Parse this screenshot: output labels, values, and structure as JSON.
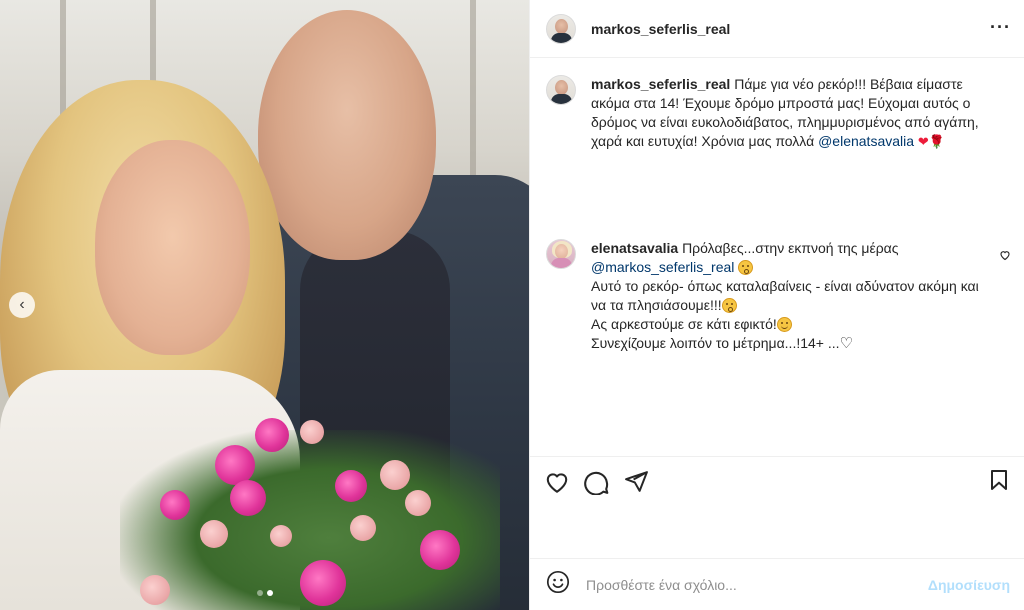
{
  "post": {
    "author": "markos_seferlis_real",
    "caption": {
      "username": "markos_seferlis_real",
      "text": "Πάμε για νέο ρεκόρ!!! Βέβαια είμαστε ακόμα στα 14! Έχουμε δρόμο μπροστά μας! Εύχομαι αυτός ο δρόμος να είναι ευκολοδιάβατος, πλημμυρισμένος από αγάπη, χαρά και ευτυχία! Χρόνια μας πολλά",
      "mention": "@elenatsavalia",
      "emojis": "❤🌹"
    },
    "comment": {
      "username": "elenatsavalia",
      "line1": "Πρόλαβες...στην εκπνοή της μέρας",
      "mention": "@markos_seferlis_real",
      "line2": "Αυτό το ρεκόρ- όπως καταλαβαίνεις - είναι αδύνατον ακόμη και να τα πλησιάσουμε!!!",
      "line3": "Ας αρκεστούμε σε κάτι εφικτό!",
      "line4": "Συνεχίζουμε λοιπόν το μέτρημα...!14+ ...",
      "heart": "♡"
    },
    "photo": {
      "slides": 2,
      "current_slide": 2
    }
  },
  "composer": {
    "placeholder": "Προσθέστε ένα σχόλιο...",
    "post_label": "Δημοσίευση"
  },
  "icons": {
    "more": "more-horizontal-icon",
    "like": "heart-outline-icon",
    "comment": "comment-bubble-icon",
    "share": "paper-plane-icon",
    "save": "bookmark-icon",
    "emoji": "emoji-smiley-icon",
    "carousel_prev": "chevron-left-icon"
  },
  "colors": {
    "mention": "#00376b",
    "post_disabled": "#b2dffc",
    "divider": "#efefef"
  }
}
